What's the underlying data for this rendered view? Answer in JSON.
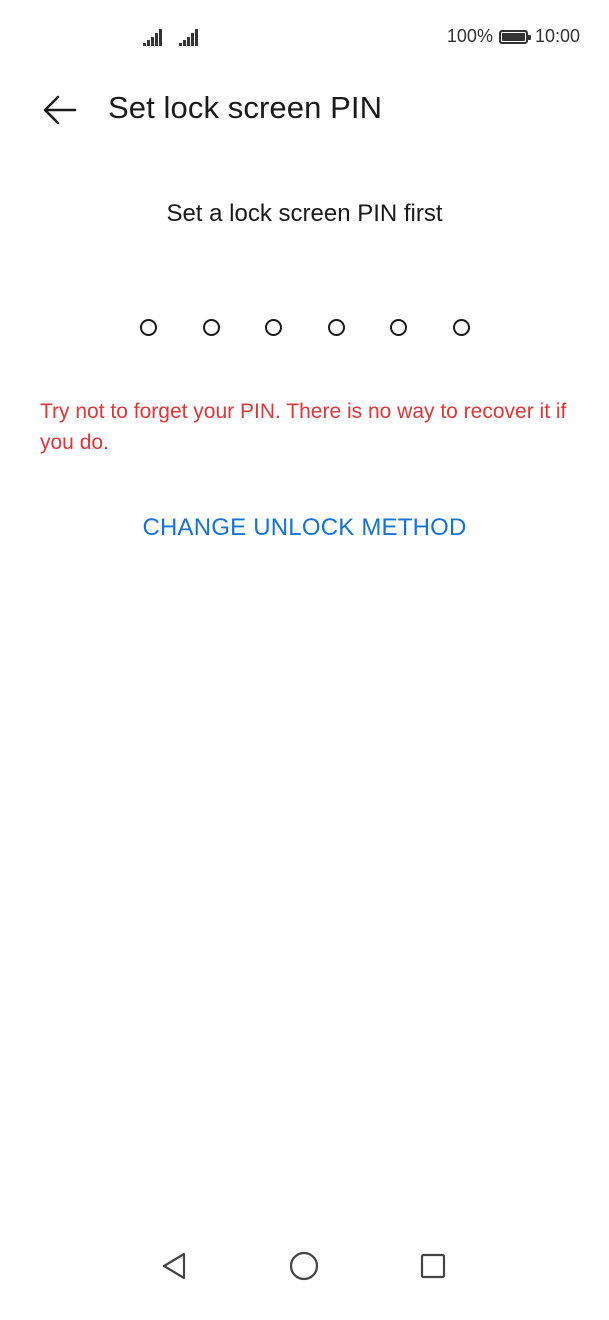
{
  "status_bar": {
    "battery_percent": "100%",
    "time": "10:00",
    "signal_icons": [
      "signal-strength-icon",
      "signal-strength-icon"
    ],
    "battery_icon": "battery-full-icon"
  },
  "header": {
    "back_icon": "back-arrow-icon",
    "title": "Set lock screen PIN"
  },
  "main": {
    "prompt": "Set a lock screen PIN first",
    "pin_length": 6,
    "pin_entered": 0,
    "warning": "Try not to forget your PIN. There is no way to recover it if you do.",
    "change_method_label": "CHANGE UNLOCK METHOD"
  },
  "nav_bar": {
    "icons": [
      "back-triangle-icon",
      "home-circle-icon",
      "recents-square-icon"
    ]
  },
  "colors": {
    "warning": "#e0363a",
    "accent": "#1673d8",
    "text": "#1a1a1a"
  }
}
